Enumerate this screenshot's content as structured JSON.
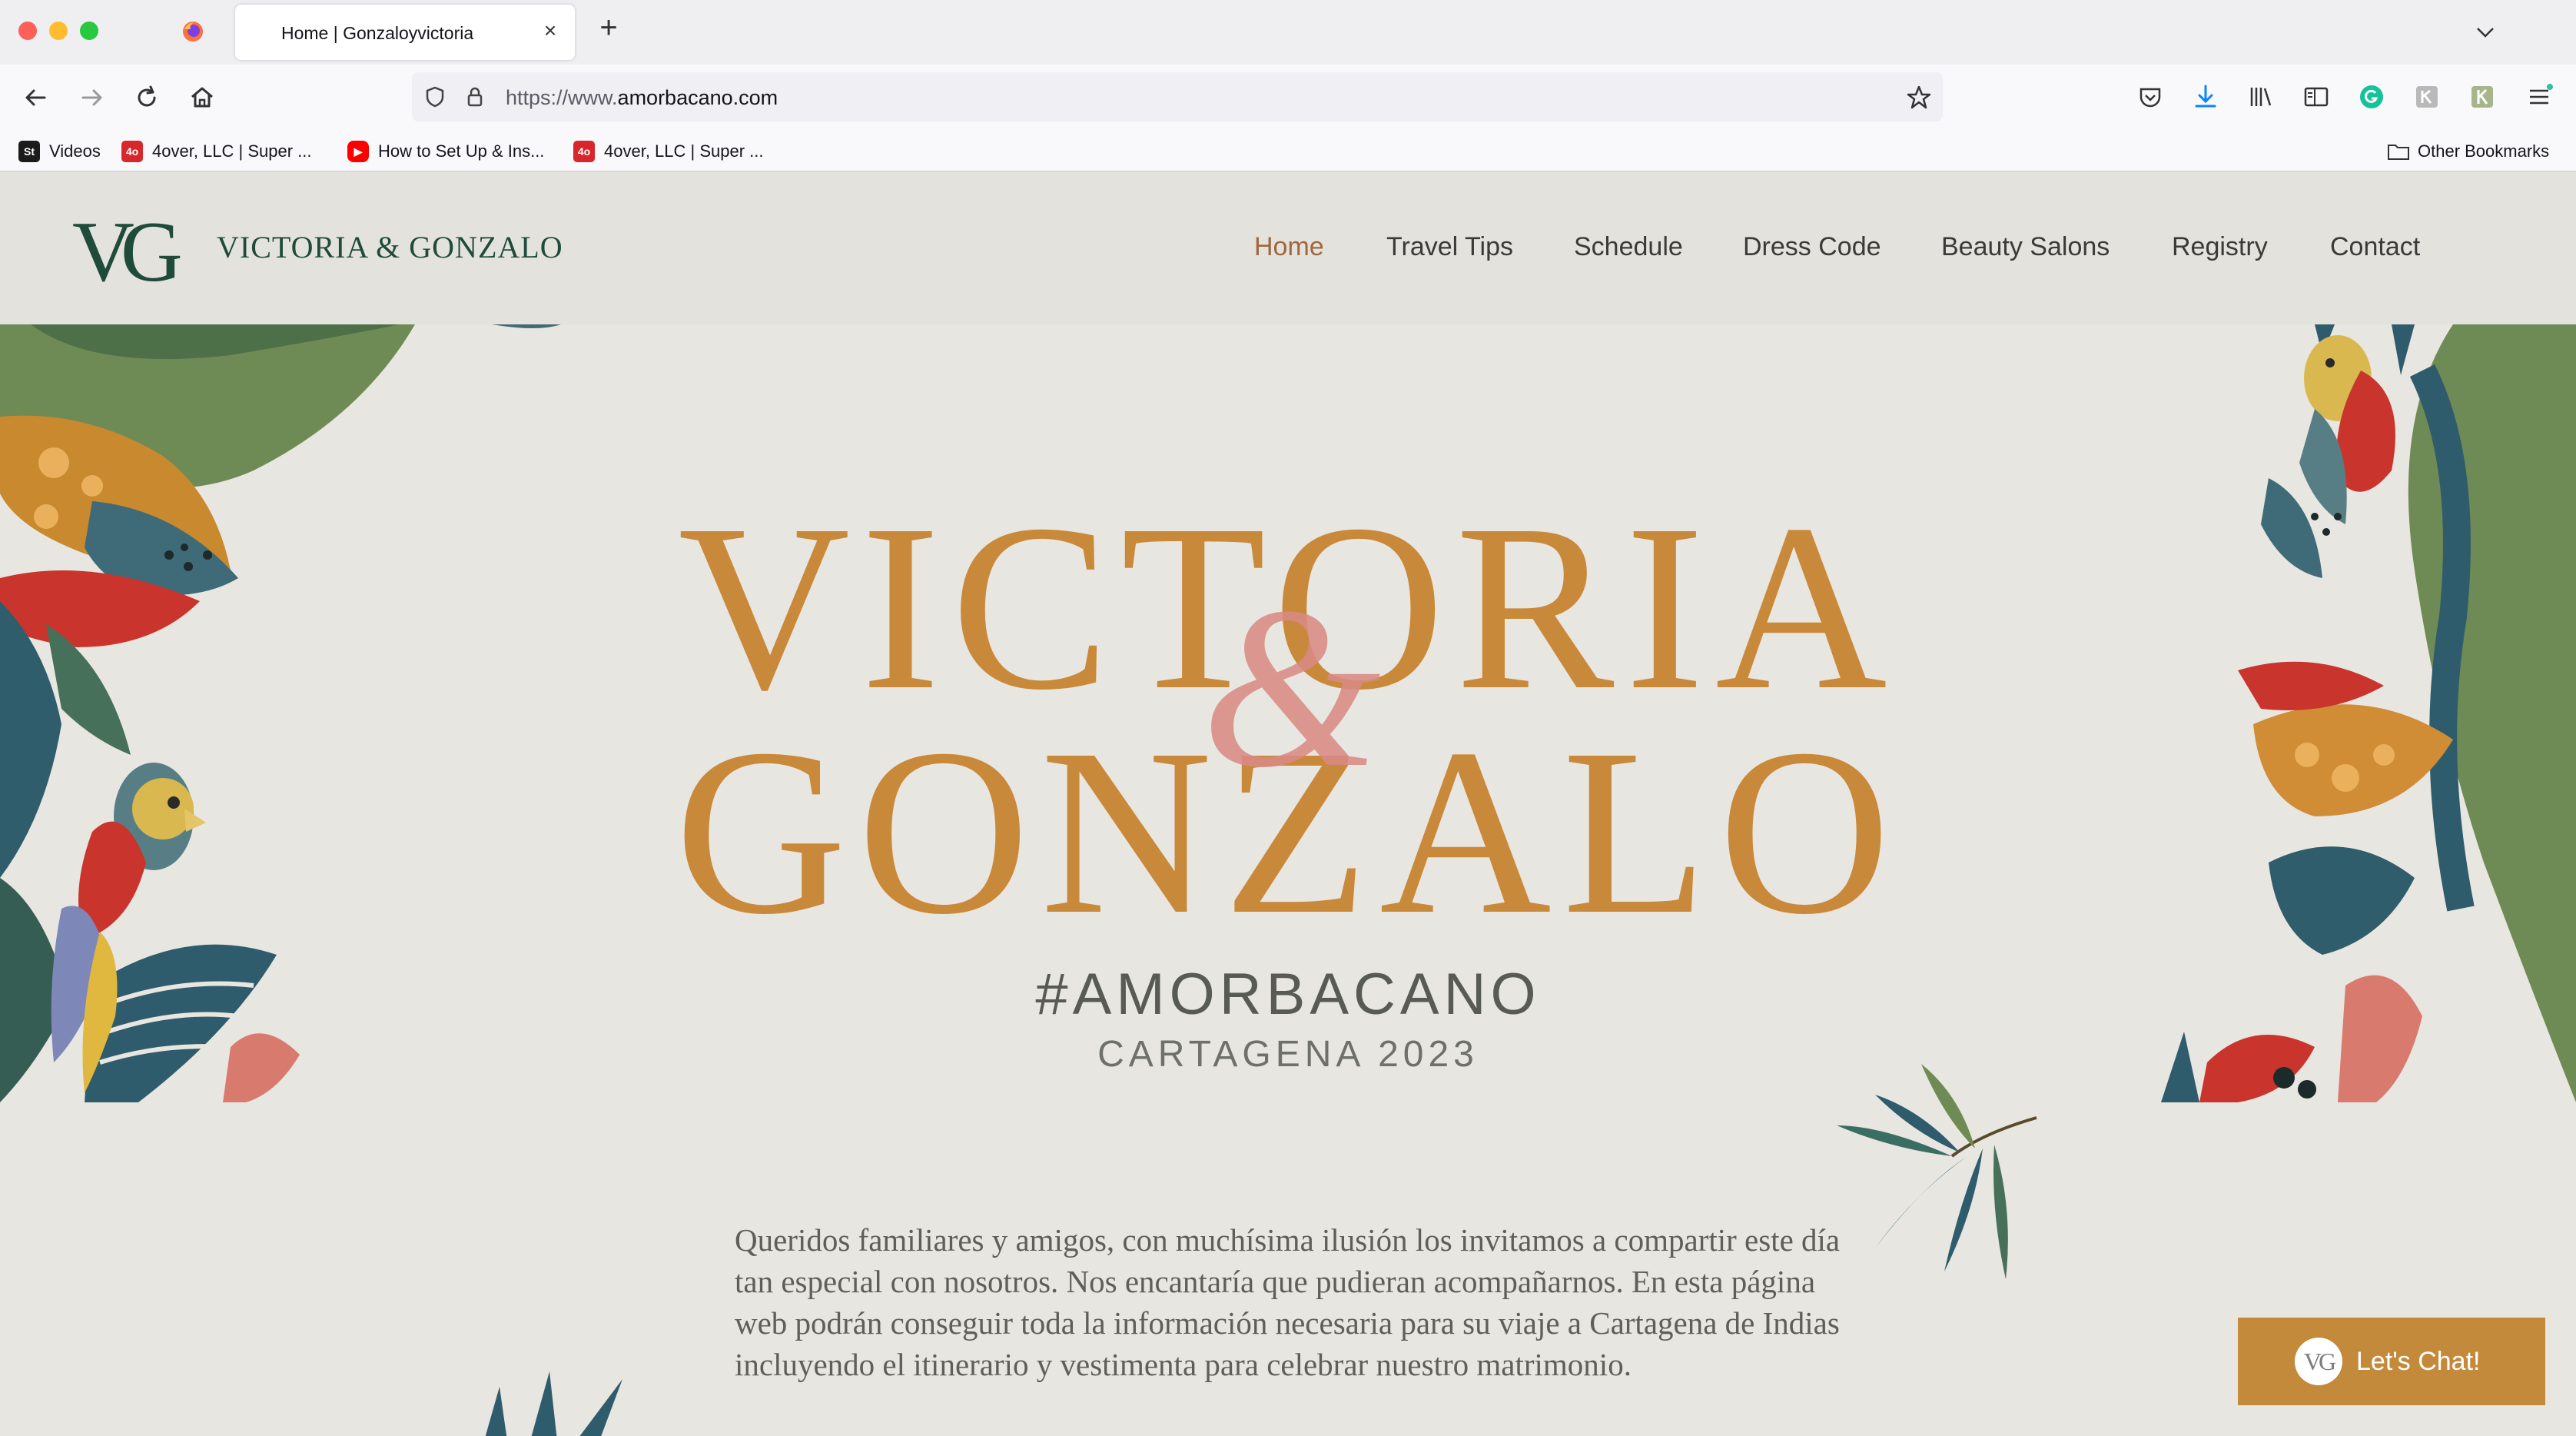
{
  "browser": {
    "tab_title": "Home | Gonzaloyvictoria",
    "url_prefix": "https://www.",
    "url_domain": "amorbacano.com",
    "bookmarks": [
      {
        "label": "Videos",
        "icon": "St",
        "color": "#1b1b1b"
      },
      {
        "label": "4over, LLC | Super ...",
        "icon": "4o",
        "color": "#d7262c"
      },
      {
        "label": "How to Set Up & Ins...",
        "icon": "youtube",
        "color": "#ff0000"
      },
      {
        "label": "4over, LLC | Super ...",
        "icon": "4o",
        "color": "#d7262c"
      }
    ],
    "other_bookmarks": "Other Bookmarks"
  },
  "site": {
    "logo_monogram": "VG",
    "logo_name": "VICTORIA & GONZALO",
    "nav": [
      "Home",
      "Travel Tips",
      "Schedule",
      "Dress Code",
      "Beauty Salons",
      "Registry",
      "Contact"
    ],
    "active_nav": "Home"
  },
  "hero": {
    "name_1": "VICTORIA",
    "ampersand": "&",
    "name_2": "GONZALO",
    "hashtag": "#AMORBACANO",
    "subline": "CARTAGENA 2023"
  },
  "intro": {
    "text": "Queridos familiares y amigos, con muchísima ilusión los invitamos a compartir este día tan especial con nosotros. Nos encantaría que pudieran acompañarnos. En esta página web podrán conseguir toda la información necesaria para su viaje a Cartagena de Indias incluyendo el itinerario y vestimenta para celebrar nuestro matrimonio."
  },
  "chat": {
    "logo": "VG",
    "label": "Let's Chat!"
  },
  "colors": {
    "gold": "#c9893a",
    "rose": "#d98b84",
    "forest": "#1f4b3a",
    "chat_bg": "#c48a3c"
  }
}
